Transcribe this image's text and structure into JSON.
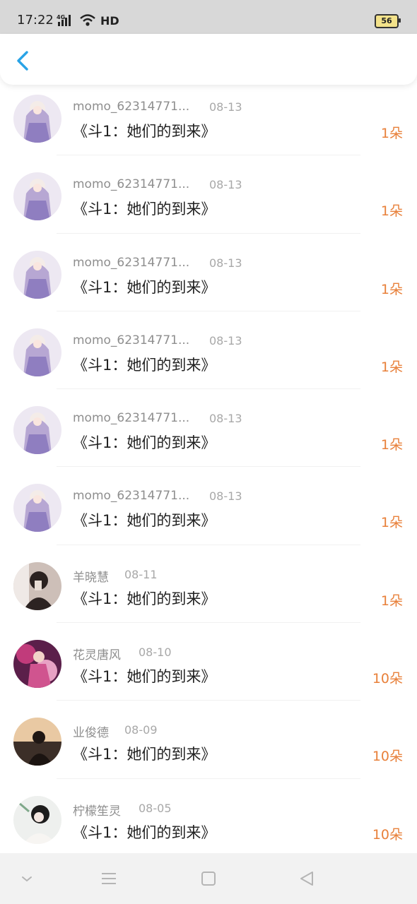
{
  "status_bar": {
    "time": "17:22",
    "network": "4G",
    "hd": "HD",
    "battery": "56"
  },
  "header": {
    "back_icon": "chevron-left-icon"
  },
  "list": [
    {
      "name": "momo_62314771...",
      "date": "08-13",
      "title": "《斗1：她们的到来》",
      "count": "1朵"
    },
    {
      "name": "momo_62314771...",
      "date": "08-13",
      "title": "《斗1：她们的到来》",
      "count": "1朵"
    },
    {
      "name": "momo_62314771...",
      "date": "08-13",
      "title": "《斗1：她们的到来》",
      "count": "1朵"
    },
    {
      "name": "momo_62314771...",
      "date": "08-13",
      "title": "《斗1：她们的到来》",
      "count": "1朵"
    },
    {
      "name": "momo_62314771...",
      "date": "08-13",
      "title": "《斗1：她们的到来》",
      "count": "1朵"
    },
    {
      "name": "momo_62314771...",
      "date": "08-13",
      "title": "《斗1：她们的到来》",
      "count": "1朵"
    },
    {
      "name": "羊晓慧",
      "date": "08-11",
      "title": "《斗1：她们的到来》",
      "count": "1朵"
    },
    {
      "name": "花灵唐风",
      "date": "08-10",
      "title": "《斗1：她们的到来》",
      "count": "10朵"
    },
    {
      "name": "业俊德",
      "date": "08-09",
      "title": "《斗1：她们的到来》",
      "count": "10朵"
    },
    {
      "name": "柠檬笙灵",
      "date": "08-05",
      "title": "《斗1：她们的到来》",
      "count": "10朵"
    }
  ],
  "colors": {
    "accent": "#29a3e6",
    "count": "#e8803a"
  },
  "nav_icons": [
    "chevron-down-icon",
    "menu-icon",
    "home-square-icon",
    "back-triangle-icon"
  ]
}
